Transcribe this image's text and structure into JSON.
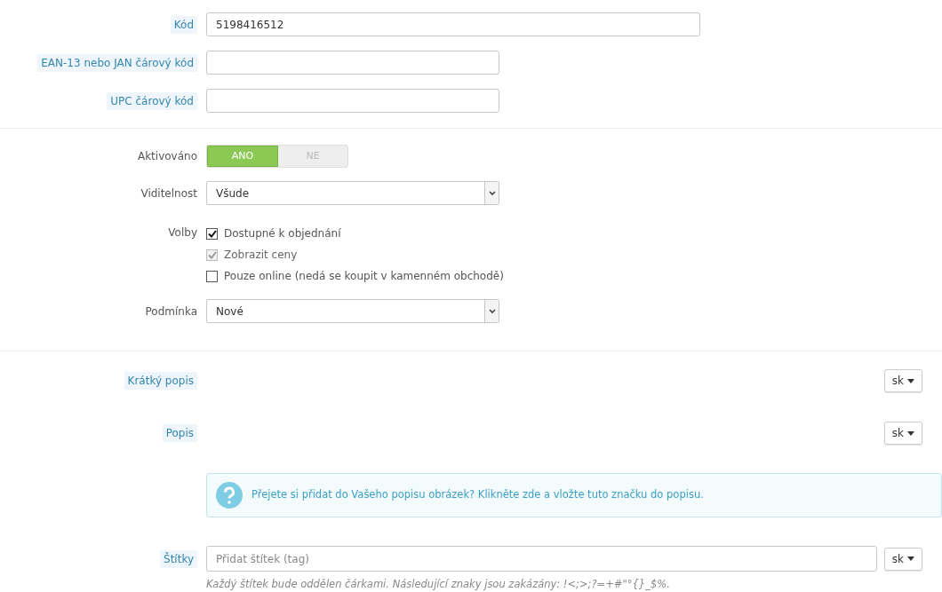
{
  "codes": [
    {
      "label": "Kód",
      "help": true,
      "value": "5198416512",
      "wide": true
    },
    {
      "label": "EAN-13 nebo JAN čárový kód",
      "help": true,
      "wide": false
    },
    {
      "label": "UPC čárový kód",
      "help": true,
      "wide": false
    }
  ],
  "enabled": {
    "label": "Aktivováno",
    "options": [
      {
        "label": "ANO",
        "selected": true
      },
      {
        "label": "NE",
        "selected": false
      }
    ]
  },
  "visibility": {
    "label": "Viditelnost",
    "value": "Všude"
  },
  "options": {
    "label": "Volby",
    "items": [
      {
        "label": "Dostupné k objednání",
        "checked": true,
        "disabled": false
      },
      {
        "label": "Zobrazit ceny",
        "checked": true,
        "disabled": true
      },
      {
        "label": "Pouze online (nedá se koupit v kamenném obchodě)",
        "checked": false,
        "disabled": false
      }
    ]
  },
  "condition": {
    "label": "Podmínka",
    "value": "Nové"
  },
  "short_description": {
    "label": "Krátký popis",
    "language": "sk"
  },
  "description": {
    "label": "Popis",
    "language": "sk"
  },
  "info": {
    "before": "Přejete si přidat do Vašeho popisu obrázek? ",
    "link": "Klikněte zde",
    "after": " a vložte tuto značku do popisu."
  },
  "tags": {
    "label": "Štítky",
    "placeholder": "Přidat štítek (tag)",
    "language": "sk",
    "hint": "Každý štítek bude oddělen čárkami. Následující znaky jsou zakázány: !<;>;?=+#\"°{}_$%."
  }
}
